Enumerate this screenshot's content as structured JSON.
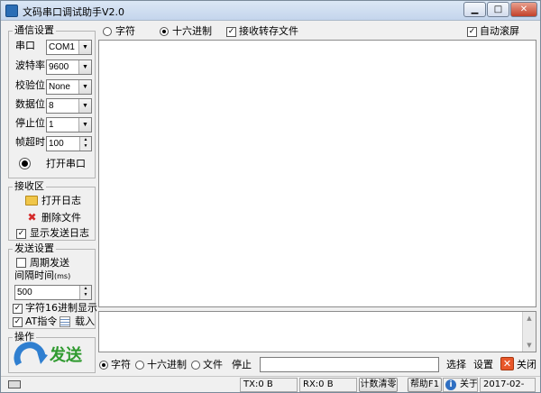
{
  "window": {
    "title": "文码串口调试助手V2.0",
    "minimize_glyph": "▁",
    "maximize_glyph": "□",
    "close_glyph": "✕"
  },
  "comm_settings": {
    "title": "通信设置",
    "port_label": "串口",
    "port_value": "COM1",
    "baud_label": "波特率",
    "baud_value": "9600",
    "parity_label": "校验位",
    "parity_value": "None",
    "databits_label": "数据位",
    "databits_value": "8",
    "stopbits_label": "停止位",
    "stopbits_value": "1",
    "timeout_label": "帧超时",
    "timeout_value": "100",
    "open_port_label": "打开串口"
  },
  "receive_area": {
    "title": "接收区",
    "open_log_label": "打开日志",
    "delete_file_label": "删除文件",
    "show_send_log_label": "显示发送日志",
    "show_send_log_checked": true
  },
  "send_settings": {
    "title": "发送设置",
    "periodic_label": "周期发送",
    "periodic_checked": false,
    "interval_label": "间隔时间",
    "interval_unit": "(ms)",
    "interval_value": "500",
    "hex_display_label": "字符16进制显示",
    "hex_display_checked": true,
    "at_cmd_label": "AT指令",
    "at_cmd_checked": true,
    "load_label": "载入"
  },
  "operation": {
    "title": "操作",
    "send_label": "发送"
  },
  "receive_toolbar": {
    "char_label": "字符",
    "char_selected": false,
    "hex_label": "十六进制",
    "hex_selected": true,
    "save_label": "接收转存文件",
    "save_checked": true,
    "autoscroll_label": "自动滚屏",
    "autoscroll_checked": true
  },
  "send_toolbar": {
    "char_label": "字符",
    "char_selected": true,
    "hex_label": "十六进制",
    "hex_selected": false,
    "file_label": "文件",
    "file_selected": false,
    "stop_label": "停止",
    "file_path_value": "",
    "select_label": "选择",
    "settings_label": "设置",
    "close_label": "关闭"
  },
  "statusbar": {
    "tx": "TX:0 B",
    "rx": "RX:0 B",
    "clear_count": "计数清零",
    "help": "帮助F1",
    "about": "关于",
    "date": "2017-02-"
  },
  "colors": {
    "send_green": "#2f9a2f",
    "send_arrow_blue": "#2f7fd0",
    "delete_red": "#d42a2a",
    "close_orange": "#e8572a"
  },
  "icons": {
    "app": "app-icon",
    "open_port_indicator": "radio-indicator-icon",
    "open_log": "folder-icon",
    "delete_file": "red-x-icon",
    "load": "document-list-icon",
    "send": "circular-arrow-icon",
    "close": "red-x-icon",
    "about": "info-icon",
    "keyboard": "keyboard-icon"
  }
}
